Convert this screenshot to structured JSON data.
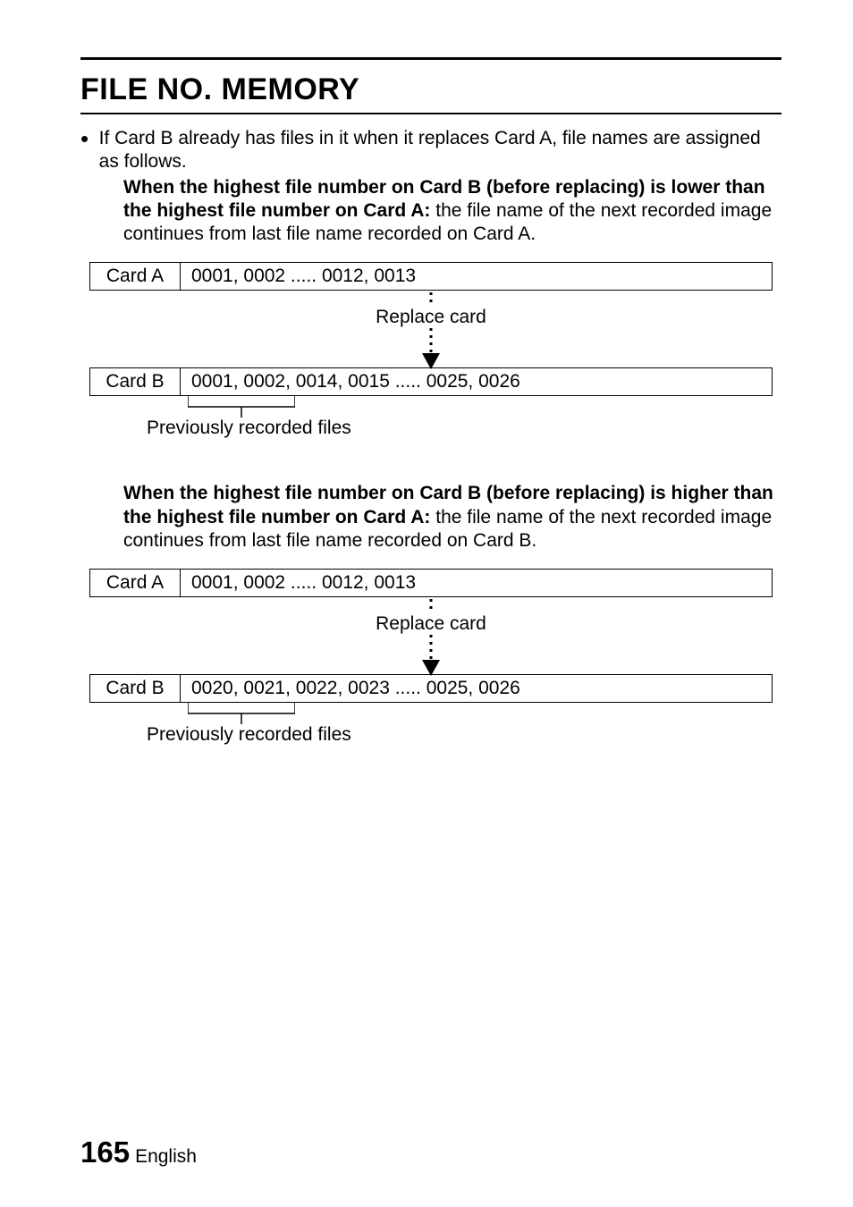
{
  "title": "FILE NO. MEMORY",
  "bullet_text": "If Card B already has files in it when it replaces Card A, file names are assigned as follows.",
  "case1": {
    "bold_lead": "When the highest file number on Card B (before replacing) is lower than the highest file number on Card A:",
    "rest": " the file name of the next recorded image continues from last file name recorded on Card A.",
    "cardA_label": "Card A",
    "cardA_values": "0001, 0002 ..... 0012, 0013",
    "replace_label": "Replace card",
    "cardB_label": "Card B",
    "cardB_values": "0001, 0002, 0014, 0015 ..... 0025, 0026",
    "prev_label": "Previously recorded files"
  },
  "case2": {
    "bold_lead": "When the highest file number on Card B (before replacing) is higher than the highest file number on Card A:",
    "rest": " the file name of the next recorded image continues from last file name recorded on Card B.",
    "cardA_label": "Card A",
    "cardA_values": "0001, 0002 ..... 0012, 0013",
    "replace_label": "Replace card",
    "cardB_label": "Card B",
    "cardB_values": "0020, 0021, 0022, 0023 ..... 0025, 0026",
    "prev_label": "Previously recorded files"
  },
  "footer": {
    "page": "165",
    "lang": "English"
  }
}
